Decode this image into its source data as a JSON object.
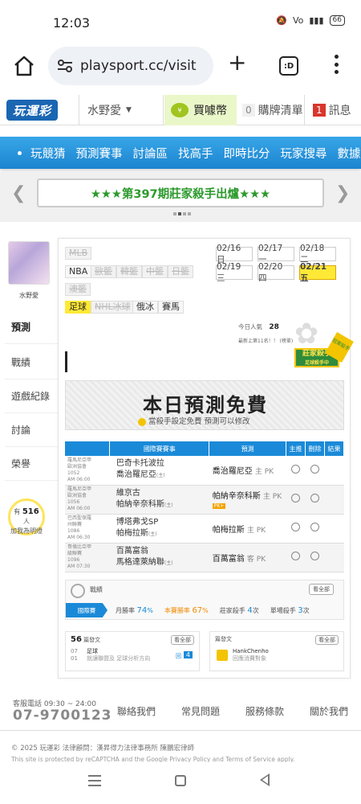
{
  "status": {
    "time": "12:03",
    "battery": "66"
  },
  "browser": {
    "url": "playsport.cc/visit",
    "tabs_label": ":D"
  },
  "top": {
    "logo": "玩運彩",
    "username": "水野愛",
    "buy_label": "買噱幣",
    "cart_count": "0",
    "cart_label": "購牌清單",
    "msg_count": "1",
    "msg_label": "訊息",
    "coin_icon": "coin-icon"
  },
  "nav": {
    "items": [
      "玩競猜",
      "預測賽事",
      "討論區",
      "找高手",
      "即時比分",
      "玩家搜尋",
      "數據"
    ]
  },
  "banner": {
    "text": "★★★第397期莊家殺手出爐★★★"
  },
  "sidebar": {
    "username": "水野愛",
    "items": [
      "預測",
      "戰績",
      "遊戲紀錄",
      "討論",
      "榮譽"
    ],
    "bulb_prefix": "有",
    "bulb_count": "516",
    "bulb_suffix": "人",
    "bulb_text": "加我為明燈"
  },
  "leagues": {
    "row1": [
      "MLB"
    ],
    "row2": [
      "NBA",
      "歐籃",
      "韓籃",
      "中籃",
      "日籃"
    ],
    "row3": [
      "澳籃"
    ],
    "row4": [
      "足球",
      "NHL冰球",
      "俄冰",
      "賽馬"
    ]
  },
  "dates": [
    "02/16 日",
    "02/17 一",
    "02/18 二",
    "02/19 三",
    "02/20 四",
    "02/21 五"
  ],
  "stats": {
    "today_label": "今日人氣",
    "today_value": "28",
    "rank_text": "最新上第11名！！ (榜單)"
  },
  "dealer": {
    "badge": "莊家殺手",
    "sub": "足球殺手中",
    "ribbon": "冠軍殺手"
  },
  "free": {
    "title": "本日預測免費",
    "sub": "當殺手設定免費 預測可以修改"
  },
  "table": {
    "headers": [
      "",
      "國際賽賽事",
      "預測",
      "主推",
      "刪除",
      "結果"
    ],
    "rows": [
      {
        "meta": [
          "羅馬尼亞甲",
          "歐洲協會",
          "1052",
          "AM 06:00"
        ],
        "home": "巴奇卡托波拉",
        "away": "喬治羅尼亞",
        "away_tag": "(主)",
        "pick": "喬治羅尼亞",
        "pick_type": "主 PK",
        "extra": ""
      },
      {
        "meta": [
          "羅馬尼亞甲",
          "歐洲協會",
          "1056",
          "AM 06:00"
        ],
        "home": "維京古",
        "away": "帕納辛奈科斯",
        "away_tag": "(主)",
        "pick": "帕納辛奈科斯",
        "pick_type": "主 PK",
        "extra": "PK+"
      },
      {
        "meta": [
          "巴西聖保羅",
          "州聯賽",
          "1086",
          "AM 06:30"
        ],
        "home": "博塔弗戈SP",
        "away": "帕梅拉斯",
        "away_tag": "(主)",
        "pick": "帕梅拉斯",
        "pick_type": "主 PK",
        "extra": ""
      },
      {
        "meta": [
          "哥倫比亞甲",
          "級聯賽",
          "1096",
          "AM 07:30"
        ],
        "home": "百萬富翁",
        "away": "馬格達萊納聯",
        "away_tag": "(主)",
        "pick": "百萬富翁",
        "pick_type": "客 PK",
        "extra": ""
      }
    ]
  },
  "record": {
    "label": "戰績",
    "all_label": "看全部",
    "pill": "國際賽",
    "win_label": "月勝率",
    "win_value": "74",
    "master_label": "本賽勝率",
    "master_value": "67",
    "killer_label": "莊家殺手",
    "killer_value": "4",
    "season_label": "單場殺手",
    "season_value": "3",
    "unit": "%",
    "times": "次"
  },
  "posts": {
    "left_count": "56",
    "left_label": "篇發文",
    "left_item_date": "07",
    "left_item_sub": "01",
    "left_item_title": "足球",
    "left_item_text": "就讓聯盟及 足球分析方向",
    "left_badge": "4",
    "left_badge_label": "回",
    "right_label": "篇發文",
    "right_user": "HankChenho",
    "right_text": "回應消費對象",
    "all_label": "看全部"
  },
  "footer": {
    "hot_label": "客服電話 09:30 ~ 24:00",
    "phone": "07-9700123",
    "links": [
      "聯絡我們",
      "常見問題",
      "服務條款",
      "關於我們"
    ],
    "copyright": "© 2025 玩運彩 法律顧問：漢昇得力法律事務所 陳鵬宏律師",
    "protected": "This site is protected by reCAPTCHA and the Google Privacy Policy and Terms of Service apply."
  },
  "colors": {
    "nav": "#1c84cf",
    "accent_green": "#2c9a2c",
    "highlight": "#ffe936",
    "blue": "#1a8ad8"
  }
}
